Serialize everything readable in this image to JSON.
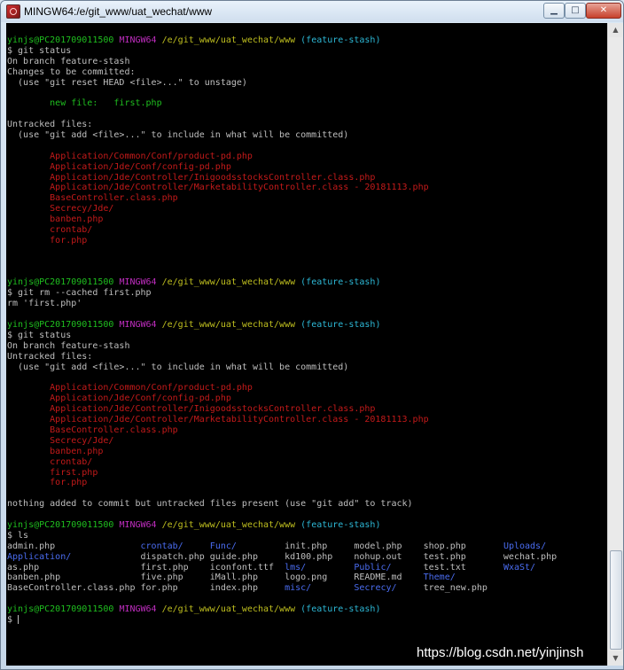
{
  "window": {
    "title": "MINGW64:/e/git_www/uat_wechat/www",
    "controls": {
      "minimize": "▁",
      "maximize": "□",
      "close": "✕"
    }
  },
  "colors": {
    "background": "#000000",
    "default_text": "#bfbfbf",
    "green": "#1fbf1f",
    "purple": "#bf2dbf",
    "yellow": "#bfbf1f",
    "cyan": "#2db8d6",
    "red": "#c41a1a",
    "blue": "#4a6cf0"
  },
  "terminal": {
    "lines": [
      [
        [
          "yinjs@PC201709011500 ",
          "green"
        ],
        [
          "MINGW64 ",
          "purple"
        ],
        [
          "/e/git_www/uat_wechat/www ",
          "yellow"
        ],
        [
          "(feature-stash)",
          "cyan"
        ]
      ],
      [
        [
          "$ git status",
          "default"
        ]
      ],
      [
        [
          "On branch feature-stash",
          "default"
        ]
      ],
      [
        [
          "Changes to be committed:",
          "default"
        ]
      ],
      [
        [
          "  (use \"git reset HEAD <file>...\" to unstage)",
          "default"
        ]
      ],
      [],
      [
        [
          "        new file:   first.php",
          "green"
        ]
      ],
      [],
      [
        [
          "Untracked files:",
          "default"
        ]
      ],
      [
        [
          "  (use \"git add <file>...\" to include in what will be committed)",
          "default"
        ]
      ],
      [],
      [
        [
          "        Application/Common/Conf/product-pd.php",
          "red"
        ]
      ],
      [
        [
          "        Application/Jde/Conf/config-pd.php",
          "red"
        ]
      ],
      [
        [
          "        Application/Jde/Controller/InigoodsstocksController.class.php",
          "red"
        ]
      ],
      [
        [
          "        Application/Jde/Controller/MarketabilityController.class - 20181113.php",
          "red"
        ]
      ],
      [
        [
          "        BaseController.class.php",
          "red"
        ]
      ],
      [
        [
          "        Secrecy/Jde/",
          "red"
        ]
      ],
      [
        [
          "        banben.php",
          "red"
        ]
      ],
      [
        [
          "        crontab/",
          "red"
        ]
      ],
      [
        [
          "        for.php",
          "red"
        ]
      ],
      [],
      [],
      [],
      [
        [
          "yinjs@PC201709011500 ",
          "green"
        ],
        [
          "MINGW64 ",
          "purple"
        ],
        [
          "/e/git_www/uat_wechat/www ",
          "yellow"
        ],
        [
          "(feature-stash)",
          "cyan"
        ]
      ],
      [
        [
          "$ git rm --cached first.php",
          "default"
        ]
      ],
      [
        [
          "rm 'first.php'",
          "default"
        ]
      ],
      [],
      [
        [
          "yinjs@PC201709011500 ",
          "green"
        ],
        [
          "MINGW64 ",
          "purple"
        ],
        [
          "/e/git_www/uat_wechat/www ",
          "yellow"
        ],
        [
          "(feature-stash)",
          "cyan"
        ]
      ],
      [
        [
          "$ git status",
          "default"
        ]
      ],
      [
        [
          "On branch feature-stash",
          "default"
        ]
      ],
      [
        [
          "Untracked files:",
          "default"
        ]
      ],
      [
        [
          "  (use \"git add <file>...\" to include in what will be committed)",
          "default"
        ]
      ],
      [],
      [
        [
          "        Application/Common/Conf/product-pd.php",
          "red"
        ]
      ],
      [
        [
          "        Application/Jde/Conf/config-pd.php",
          "red"
        ]
      ],
      [
        [
          "        Application/Jde/Controller/InigoodsstocksController.class.php",
          "red"
        ]
      ],
      [
        [
          "        Application/Jde/Controller/MarketabilityController.class - 20181113.php",
          "red"
        ]
      ],
      [
        [
          "        BaseController.class.php",
          "red"
        ]
      ],
      [
        [
          "        Secrecy/Jde/",
          "red"
        ]
      ],
      [
        [
          "        banben.php",
          "red"
        ]
      ],
      [
        [
          "        crontab/",
          "red"
        ]
      ],
      [
        [
          "        first.php",
          "red"
        ]
      ],
      [
        [
          "        for.php",
          "red"
        ]
      ],
      [],
      [
        [
          "nothing added to commit but untracked files present (use \"git add\" to track)",
          "default"
        ]
      ],
      [],
      [
        [
          "yinjs@PC201709011500 ",
          "green"
        ],
        [
          "MINGW64 ",
          "purple"
        ],
        [
          "/e/git_www/uat_wechat/www ",
          "yellow"
        ],
        [
          "(feature-stash)",
          "cyan"
        ]
      ],
      [
        [
          "$ ls",
          "default"
        ]
      ],
      [
        [
          "admin.php                ",
          "default"
        ],
        [
          "crontab/",
          "blue"
        ],
        [
          "     ",
          "default"
        ],
        [
          "Func/",
          "blue"
        ],
        [
          "         init.php     model.php    shop.php       ",
          "default"
        ],
        [
          "Uploads/",
          "blue"
        ]
      ],
      [
        [
          "Application/",
          "blue"
        ],
        [
          "             dispatch.php guide.php     kd100.php    nohup.out    test.php       wechat.php",
          "default"
        ]
      ],
      [
        [
          "as.php                   first.php    iconfont.ttf  ",
          "default"
        ],
        [
          "lms/",
          "blue"
        ],
        [
          "         ",
          "default"
        ],
        [
          "Public/",
          "blue"
        ],
        [
          "      test.txt       ",
          "default"
        ],
        [
          "WxaSt/",
          "blue"
        ]
      ],
      [
        [
          "banben.php               five.php     iMall.php     logo.png     README.md    ",
          "default"
        ],
        [
          "Theme/",
          "blue"
        ]
      ],
      [
        [
          "BaseController.class.php for.php      index.php     ",
          "default"
        ],
        [
          "misc/",
          "blue"
        ],
        [
          "        ",
          "default"
        ],
        [
          "Secrecy/",
          "blue"
        ],
        [
          "     tree_new.php",
          "default"
        ]
      ],
      [],
      [
        [
          "yinjs@PC201709011500 ",
          "green"
        ],
        [
          "MINGW64 ",
          "purple"
        ],
        [
          "/e/git_www/uat_wechat/www ",
          "yellow"
        ],
        [
          "(feature-stash)",
          "cyan"
        ]
      ],
      [
        [
          "$ ",
          "default"
        ]
      ]
    ]
  },
  "watermark": "https://blog.csdn.net/yinjinsh"
}
